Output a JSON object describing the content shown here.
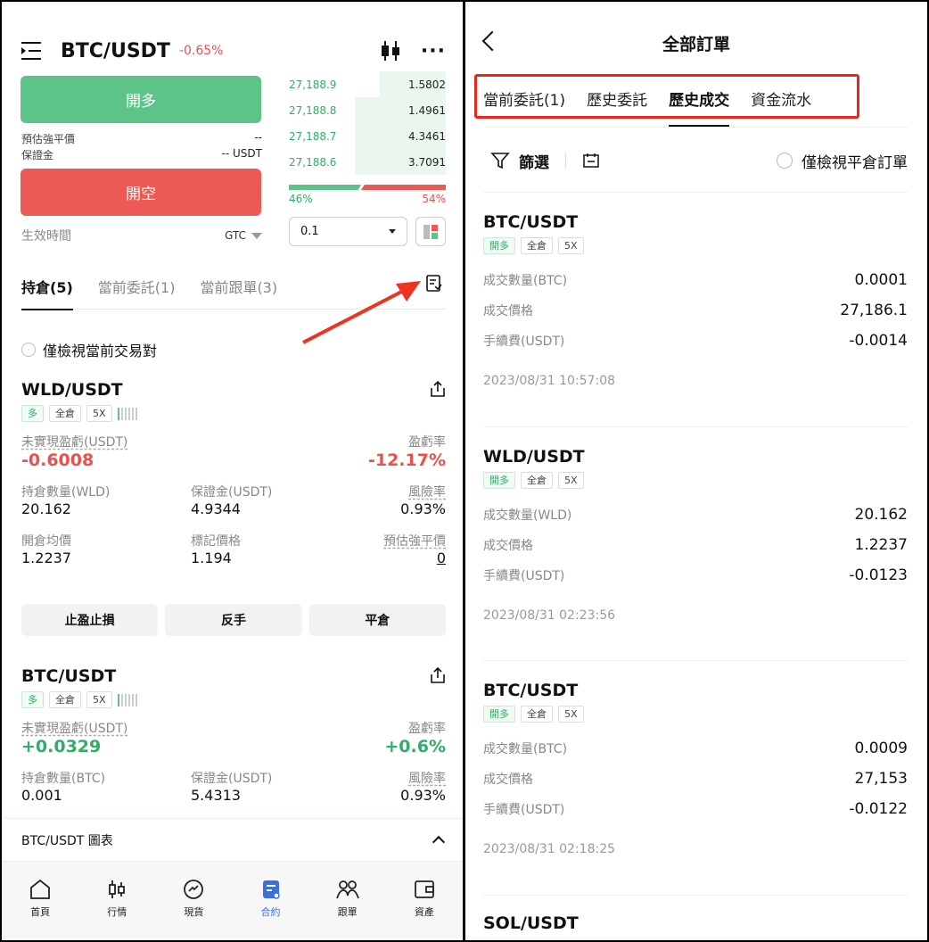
{
  "left": {
    "pair": "BTC/USDT",
    "change": "-0.65%",
    "long_btn": "開多",
    "short_btn": "開空",
    "est_liq_label": "預估強平價",
    "est_liq_value": "--",
    "margin_label": "保證金",
    "margin_value": "-- USDT",
    "valid_label": "生效時間",
    "valid_value": "GTC",
    "orderbook": [
      {
        "price": "27,188.9",
        "qty": "1.5802",
        "depth": 0.42
      },
      {
        "price": "27,188.8",
        "qty": "1.4961",
        "depth": 0.58
      },
      {
        "price": "27,188.7",
        "qty": "4.3461",
        "depth": 0.58
      },
      {
        "price": "27,188.6",
        "qty": "3.7091",
        "depth": 0.58
      }
    ],
    "buy_ratio": "46%",
    "sell_ratio": "54%",
    "buy_fraction": 0.46,
    "qty_select": "0.1",
    "tabs": [
      "持倉(5)",
      "當前委託(1)",
      "當前跟單(3)"
    ],
    "only_current": "僅檢視當前交易對",
    "positions": [
      {
        "pair": "WLD/USDT",
        "side": "多",
        "mode": "全倉",
        "lev": "5X",
        "pnl_label": "未實現盈虧(USDT)",
        "pnl": "-0.6008",
        "roe_label": "盈虧率",
        "roe": "-12.17%",
        "qty_label": "持倉數量(WLD)",
        "qty": "20.162",
        "margin_label": "保證金(USDT)",
        "margin": "4.9344",
        "risk_label": "風險率",
        "risk": "0.93%",
        "entry_label": "開倉均價",
        "entry": "1.2237",
        "mark_label": "標記價格",
        "mark": "1.194",
        "liq_label": "預估強平價",
        "liq": "0",
        "risk_level": 1
      },
      {
        "pair": "BTC/USDT",
        "side": "多",
        "mode": "全倉",
        "lev": "5X",
        "pnl_label": "未實現盈虧(USDT)",
        "pnl": "+0.0329",
        "roe_label": "盈虧率",
        "roe": "+0.6%",
        "qty_label": "持倉數量(BTC)",
        "qty": "0.001",
        "margin_label": "保證金(USDT)",
        "margin": "5.4313",
        "risk_label": "風險率",
        "risk": "0.93%",
        "risk_level": 1
      }
    ],
    "actions": [
      "止盈止損",
      "反手",
      "平倉"
    ],
    "chart_label": "BTC/USDT 圖表",
    "nav": [
      "首頁",
      "行情",
      "現貨",
      "合約",
      "跟單",
      "資產"
    ]
  },
  "right": {
    "title": "全部訂單",
    "tabs": [
      "當前委託(1)",
      "歷史委託",
      "歷史成交",
      "資金流水"
    ],
    "filter": "篩選",
    "close_only": "僅檢視平倉訂單",
    "trades": [
      {
        "pair": "BTC/USDT",
        "side": "開多",
        "mode": "全倉",
        "lev": "5X",
        "qty_label": "成交數量(BTC)",
        "qty": "0.0001",
        "price_label": "成交價格",
        "price": "27,186.1",
        "fee_label": "手續費(USDT)",
        "fee": "-0.0014",
        "time": "2023/08/31 10:57:08"
      },
      {
        "pair": "WLD/USDT",
        "side": "開多",
        "mode": "全倉",
        "lev": "5X",
        "qty_label": "成交數量(WLD)",
        "qty": "20.162",
        "price_label": "成交價格",
        "price": "1.2237",
        "fee_label": "手續費(USDT)",
        "fee": "-0.0123",
        "time": "2023/08/31 02:23:56"
      },
      {
        "pair": "BTC/USDT",
        "side": "開多",
        "mode": "全倉",
        "lev": "5X",
        "qty_label": "成交數量(BTC)",
        "qty": "0.0009",
        "price_label": "成交價格",
        "price": "27,153",
        "fee_label": "手續費(USDT)",
        "fee": "-0.0122",
        "time": "2023/08/31 02:18:25"
      },
      {
        "pair": "SOL/USDT"
      }
    ]
  },
  "colors": {
    "green": "#5dc489",
    "red": "#ec5a55",
    "accent": "#3b6fe0",
    "highlight": "#e8281f"
  }
}
